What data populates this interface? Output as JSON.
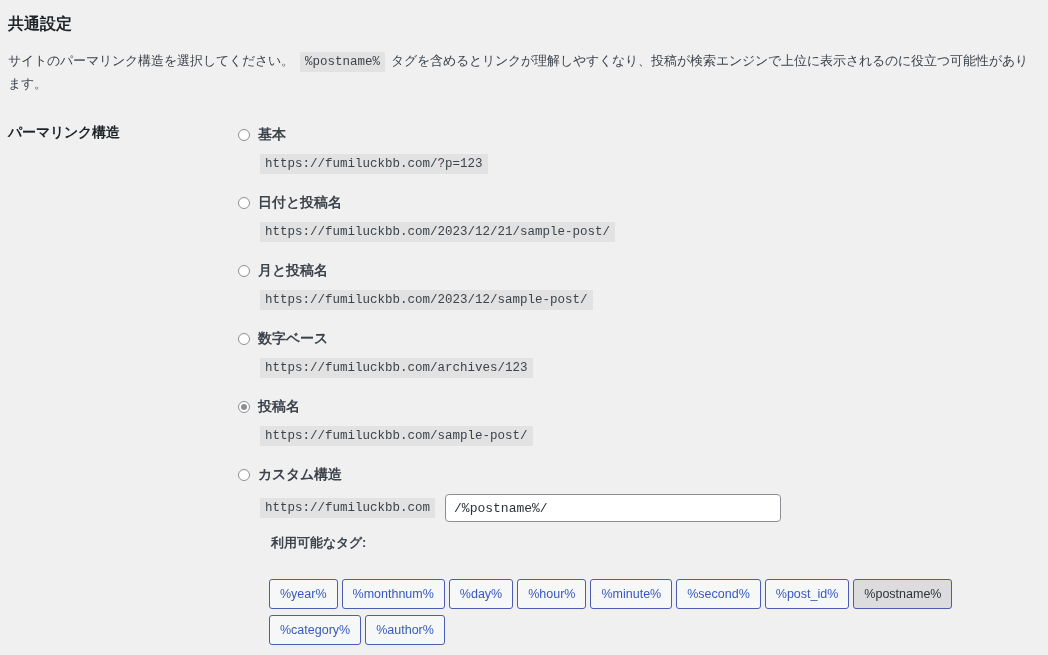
{
  "section_title": "共通設定",
  "description": [
    {
      "kind": "text",
      "text": "サイトのパーマリンク構造を選択してください。"
    },
    {
      "kind": "code",
      "text": "%postname%"
    },
    {
      "kind": "text",
      "text": "タグを含めるとリンクが理解しやすくなり、投稿が検索エンジンで上位に表示されるのに役立つ可能性があります。"
    }
  ],
  "field_label": "パーマリンク構造",
  "options": [
    {
      "label": "基本",
      "selected": false,
      "example": "https://fumiluckbb.com/?p=123"
    },
    {
      "label": "日付と投稿名",
      "selected": false,
      "example": "https://fumiluckbb.com/2023/12/21/sample-post/"
    },
    {
      "label": "月と投稿名",
      "selected": false,
      "example": "https://fumiluckbb.com/2023/12/sample-post/"
    },
    {
      "label": "数字ベース",
      "selected": false,
      "example": "https://fumiluckbb.com/archives/123"
    },
    {
      "label": "投稿名",
      "selected": true,
      "example": "https://fumiluckbb.com/sample-post/"
    }
  ],
  "custom": {
    "label": "カスタム構造",
    "selected": false,
    "prefix": "https://fumiluckbb.com",
    "value": "/%postname%/"
  },
  "tags_label": "利用可能なタグ:",
  "tags": [
    {
      "text": "%year%",
      "selected": false
    },
    {
      "text": "%monthnum%",
      "selected": false
    },
    {
      "text": "%day%",
      "selected": false
    },
    {
      "text": "%hour%",
      "selected": false
    },
    {
      "text": "%minute%",
      "selected": false
    },
    {
      "text": "%second%",
      "selected": false
    },
    {
      "text": "%post_id%",
      "selected": false
    },
    {
      "text": "%postname%",
      "selected": true
    },
    {
      "text": "%category%",
      "selected": false
    },
    {
      "text": "%author%",
      "selected": false
    }
  ]
}
